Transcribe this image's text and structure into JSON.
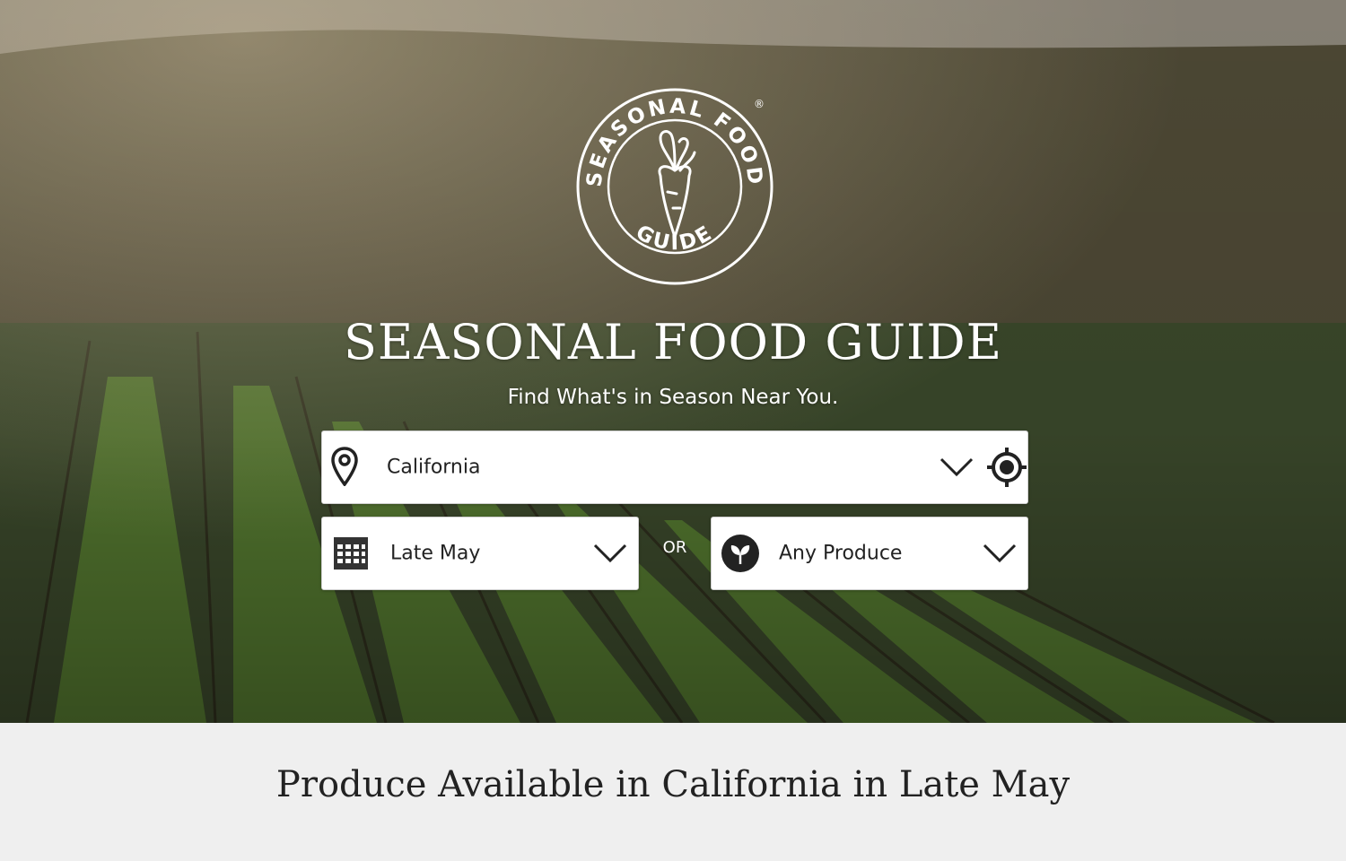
{
  "brand": {
    "logo_top_text": "SEASONAL FOOD",
    "logo_bottom_text": "GUIDE",
    "registered_mark": "®",
    "title": "SEASONAL FOOD GUIDE",
    "tagline": "Find What's in Season Near You."
  },
  "search": {
    "location_value": "California",
    "date_value": "Late May",
    "or_label": "OR",
    "produce_value": "Any Produce"
  },
  "results": {
    "heading": "Produce Available in California in Late May"
  },
  "icons": {
    "location": "map-pin-icon",
    "locate": "crosshair-icon",
    "calendar": "calendar-icon",
    "produce": "sprout-icon",
    "dropdown": "chevron-down-icon"
  },
  "colors": {
    "field_bg": "#ffffff",
    "text": "#222222",
    "bottom_bg": "#efefef",
    "hero_text": "#ffffff"
  }
}
